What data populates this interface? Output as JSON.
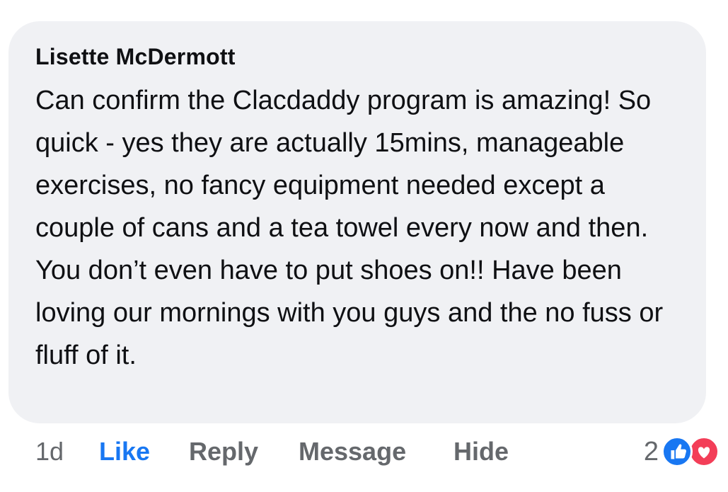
{
  "comment": {
    "author": "Lisette McDermott",
    "text": "Can confirm the Clacdaddy program is amazing! So quick - yes they are actually 15mins, manageable exercises, no fancy equipment needed except a couple of cans and a tea towel every now and then. You don’t even have to put shoes on!! Have been loving our mornings with you guys and the no fuss or fluff of it."
  },
  "actions": {
    "time": "1d",
    "like_label": "Like",
    "reply_label": "Reply",
    "message_label": "Message",
    "hide_label": "Hide"
  },
  "reactions": {
    "count": "2",
    "types": [
      "like-icon",
      "love-icon"
    ],
    "like_color": "#1877f2",
    "love_color": "#f33e58"
  }
}
